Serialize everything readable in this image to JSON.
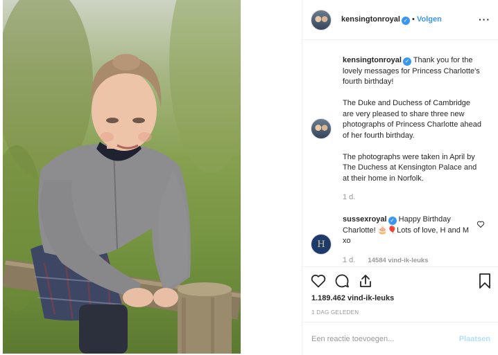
{
  "post": {
    "image_alt": "Princess Charlotte leaning on a wooden fence",
    "author": "kensingtonroyal",
    "follow_label": "Volgen",
    "more_label": "···"
  },
  "caption": {
    "username": "kensingtonroyal",
    "paragraphs": [
      "Thank you for the lovely messages for Princess Charlotte's fourth birthday!",
      "The Duke and Duchess of Cambridge are very pleased to share three new photographs of Princess Charlotte ahead of her fourth birthday.",
      "The photographs were taken in April by The Duchess at Kensington Palace and at their home in Norfolk."
    ],
    "time": "1 d."
  },
  "comments": [
    {
      "username": "sussexroyal",
      "text": "Happy Birthday Charlotte! 🎂🎈Lots of love, H and M xo",
      "avatar_monogram": "H",
      "time": "1 d.",
      "likes": "14584 vind-ik-leuks"
    }
  ],
  "actions": {
    "likes": "1.189.462 vind-ik-leuks",
    "date": "1 DAG GELEDEN"
  },
  "add_comment": {
    "placeholder": "Een reactie toevoegen...",
    "post_label": "Plaatsen"
  },
  "colors": {
    "link": "#3897f0",
    "muted": "#999999",
    "border": "#efefef",
    "post_disabled": "#b2dffc"
  },
  "icons": [
    "heart-icon",
    "comment-icon",
    "share-icon",
    "bookmark-icon",
    "verified-icon",
    "more-icon"
  ]
}
